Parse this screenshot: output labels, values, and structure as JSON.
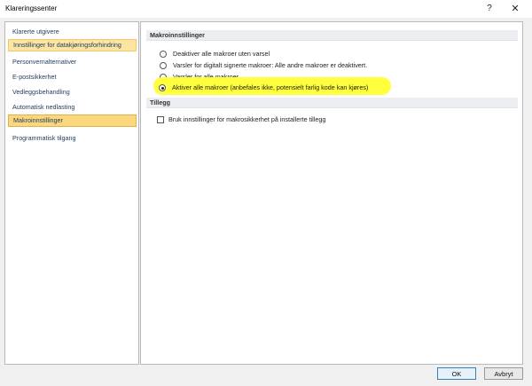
{
  "window": {
    "title": "Klareringssenter",
    "help_glyph": "?",
    "close_glyph": "✕"
  },
  "sidebar": {
    "items": [
      {
        "label": "Klarerte utgivere"
      },
      {
        "label": "Innstillinger for datakjøringsforhindring"
      },
      {
        "label": "Personvernalternativer"
      },
      {
        "label": "E-postsikkerhet"
      },
      {
        "label": "Vedleggsbehandling"
      },
      {
        "label": "Automatisk nedlasting"
      },
      {
        "label": "Makroinnstillinger"
      },
      {
        "label": "Programmatisk tilgang"
      }
    ],
    "selected": "Makroinnstillinger"
  },
  "macro_section": {
    "title": "Makroinnstillinger",
    "options": [
      {
        "label": "Deaktiver alle makroer uten varsel",
        "checked": false
      },
      {
        "label": "Varsler for digitalt signerte makroer: Alle andre makroer er deaktivert.",
        "checked": false
      },
      {
        "label": "Varsler for alle makroer",
        "checked": false
      },
      {
        "label": "Aktiver alle makroer (anbefales ikke, potensielt farlig kode kan kjøres)",
        "checked": true
      }
    ]
  },
  "addins_section": {
    "title": "Tillegg",
    "checkbox_label": "Bruk innstillinger for makrosikkerhet på installerte tillegg",
    "checked": false
  },
  "buttons": {
    "ok_label": "OK",
    "cancel_label": "Avbryt"
  },
  "colors": {
    "selected_item": "#fbd77e",
    "highlight_marker": "#ffff33"
  }
}
